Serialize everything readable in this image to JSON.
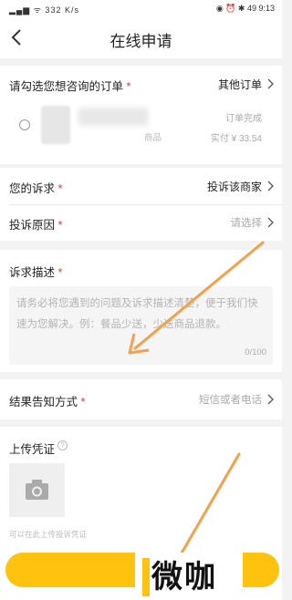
{
  "status_bar": {
    "left": "▂▄▆ ᯤ 332 K/s",
    "right": "◉ ⏰ ✱ 49 9:13"
  },
  "nav": {
    "title": "在线申请"
  },
  "order_section": {
    "label": "请勾选您想咨询的订单",
    "required_mark": "*",
    "other_orders": "其他订单",
    "item_category": "商品",
    "status": "订单完成",
    "price": "实付 ¥ 33.54"
  },
  "appeal": {
    "label": "您的诉求",
    "required_mark": "*",
    "value": "投诉该商家"
  },
  "reason": {
    "label": "投诉原因",
    "required_mark": "*",
    "placeholder": "请选择"
  },
  "description": {
    "label": "诉求描述",
    "required_mark": "*",
    "placeholder": "请务必将您遇到的问题及诉求描述清楚，便于我们快速为您解决。例：餐品少送，少送商品退款。",
    "counter": "0/100"
  },
  "notify": {
    "label": "结果告知方式",
    "required_mark": "*",
    "placeholder": "短信或者电话"
  },
  "upload": {
    "title": "上传凭证",
    "help_icon": "?",
    "hint": "可以在此上传投诉凭证"
  },
  "watermark": {
    "text": "微咖"
  },
  "colors": {
    "accent": "#ffc20e",
    "arrow": "#f5a04a",
    "required": "#e33333"
  }
}
